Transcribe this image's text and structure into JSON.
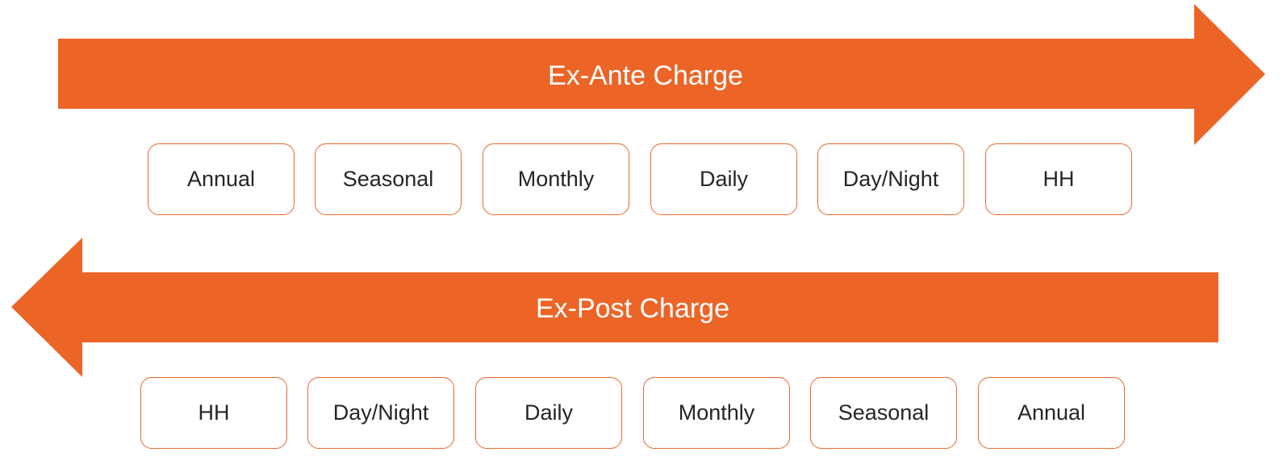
{
  "colors": {
    "accent": "#EC6526",
    "box_border": "#E8682A",
    "box_text": "#262626",
    "arrow_text": "#FFFFFF"
  },
  "ex_ante": {
    "label": "Ex-Ante Charge",
    "direction": "right",
    "items": [
      "Annual",
      "Seasonal",
      "Monthly",
      "Daily",
      "Day/Night",
      "HH"
    ]
  },
  "ex_post": {
    "label": "Ex-Post Charge",
    "direction": "left",
    "items": [
      "HH",
      "Day/Night",
      "Daily",
      "Monthly",
      "Seasonal",
      "Annual"
    ]
  }
}
